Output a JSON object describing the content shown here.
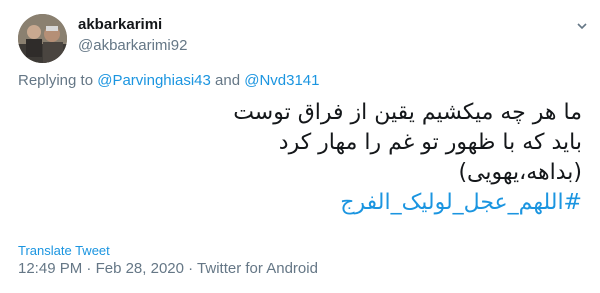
{
  "author": {
    "display_name": "akbarkarimi",
    "handle": "@akbarkarimi92",
    "avatar_icon": "user-avatar-photo"
  },
  "menu": {
    "icon": "chevron-down-icon"
  },
  "reply": {
    "prefix": "Replying to ",
    "mention1": "@Parvinghiasi43",
    "conjunction": " and ",
    "mention2": "@Nvd3141"
  },
  "tweet": {
    "line1": "ما هر چه میکشیم یقین از فراق توست",
    "line2": "باید که با ظهور تو غم را مهار کرد",
    "line3": "(بداهه،یهویی)",
    "hashtag": "#اللهم_عجل_لولیک_الفرج"
  },
  "translate_label": "Translate Tweet",
  "meta": {
    "time": "12:49 PM",
    "separator": " · ",
    "date": "Feb 28, 2020",
    "source": "Twitter for Android"
  },
  "colors": {
    "link": "#1b95e0",
    "secondary": "#657786",
    "text": "#14171a"
  }
}
